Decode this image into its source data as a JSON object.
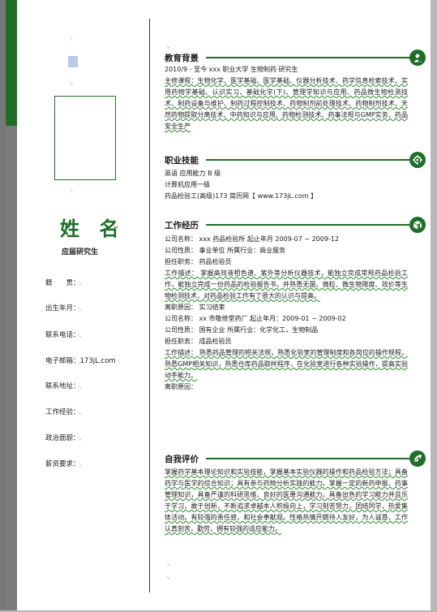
{
  "left": {
    "name": "姓 名",
    "name_mark": "↵",
    "title": "应届研究生",
    "fields": [
      {
        "label": "籍　　贯：",
        "suffix": "·,"
      },
      {
        "label": "出生年月：",
        "suffix": "·,"
      },
      {
        "label": "联系电话：",
        "suffix": "·,"
      },
      {
        "label": "电子邮箱：173jL.com",
        "suffix": "·,"
      },
      {
        "label": "联系地址：",
        "suffix": "·,"
      },
      {
        "label": "工作经验：",
        "suffix": "·,"
      },
      {
        "label": "政治面貌：",
        "suffix": "·,"
      },
      {
        "label": "薪资要求：",
        "suffix": "·,"
      }
    ]
  },
  "education": {
    "title": "教育背景",
    "line1": "2010/9 - 至今        xxx 职业大学        生物制药          研究生",
    "courses": "主修课程：生物化学、医学基础、医学基础、仪器分析技术、药学信息检索技术、实用药物学基础、认识实习、基础化学(下)、管理学知识与应用、药品微生物检测技术、制药设备与维护、制药过程控制技术、药物制剂前处理技术、药物制剂技术、天然药物提取分离技术、中药知识与应用、药物检测技术、药事法规与GMP实务、药品安全生产"
  },
  "skills": {
    "title": "职业技能",
    "items": [
      "英语 应用能力 B 级",
      "计算机应用一级",
      "药品检验工(高级)173 简历网【 www.173jL.com 】"
    ]
  },
  "work": {
    "title": "工作经历",
    "job1": {
      "company": "公司名称： xxx 药品检验所          起止年月 2009-07  ~  2009-12",
      "nature": "公司性质：  事业单位                    所属行业：商业服务",
      "position": "担任职务：  药品检验员",
      "desc": "工作描述：  掌握高效液相色谱、紫外等分析仪器技术，能独立完成常规药品检验工作，能独立完成一份药品的检验报告书，并熟悉无菌、微粒、微生物限度、效价等生物检测技术，对药品检验工作有了很大的认识与提高。",
      "reason": "离职原因：  实习结束"
    },
    "job2": {
      "company": "公司名称： xx 市敬修堂药厂              起止年月：2009-01  ~  2009-02",
      "nature": "公司性质：  国有企业                    所属行业：化学化工，生物制品",
      "position": "担任职务：  成品检验员",
      "desc": "工作描述：  熟悉药品管理的相关法规，熟悉化验室的管理制度和各岗位的操作规程，熟悉GMP相关知识，熟悉仓库药品取样程序，在化验室进行各种实验操作，提高实验动手能力。",
      "reason": "离职原因："
    }
  },
  "self": {
    "title": "自我评价",
    "text": "掌握药学基本理论知识和实验技能，掌握基本实验仪器的操作和药品检验方法；具备药学与医学的综合知识；具有参与药物分析实践的能力。掌握一定的新药申报、药事管理知识，具备严谨的科研思维、良好的医患沟通能力。具备出色的学习能力并且乐于学习、敢于创新，不断追求卓越本人积极向上，学习刻苦努力，团结同学，热爱集体活动。有较强的责任感，和社会奉献观。性格热情开朗待人友好，为人诚恳，工作认真刻苦，勤劳，拥有较强的适应能力。"
  },
  "colors": {
    "accent": "#1e6e28"
  },
  "icons": [
    "graduate-icon",
    "target-icon",
    "box-icon",
    "leaf-icon"
  ]
}
